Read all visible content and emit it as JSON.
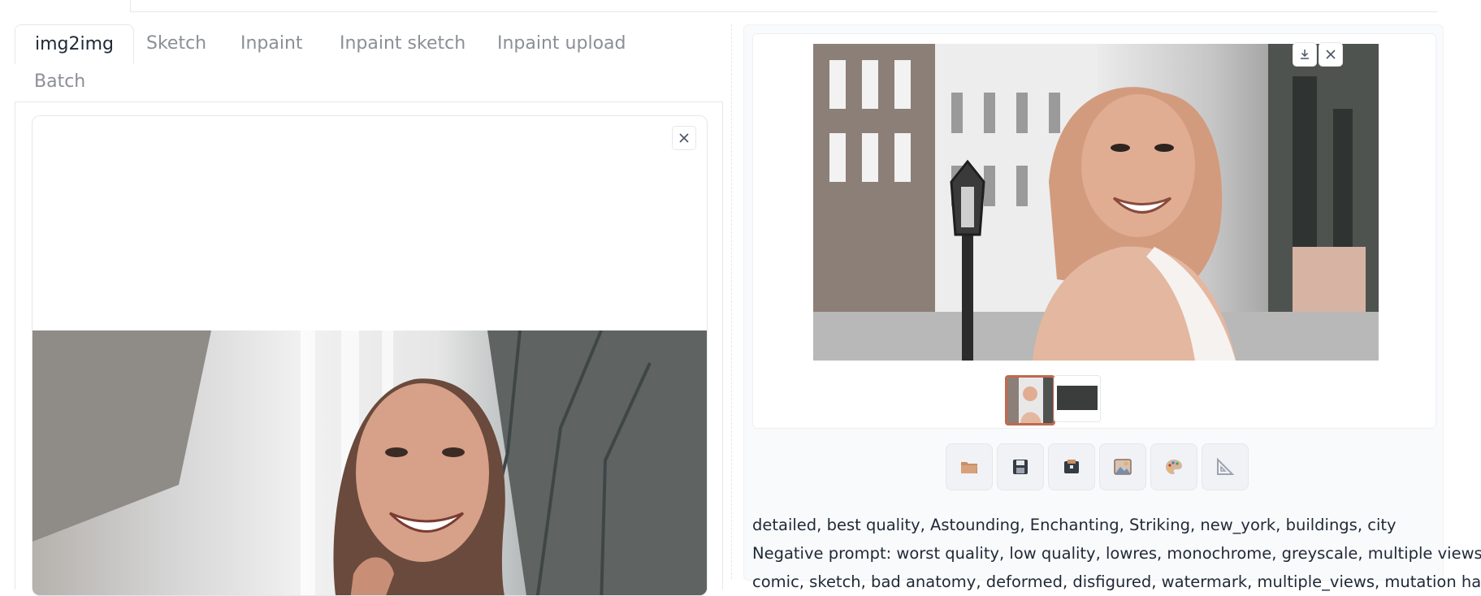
{
  "tabs": {
    "items": [
      {
        "label": "img2img",
        "active": true
      },
      {
        "label": "Sketch",
        "active": false
      },
      {
        "label": "Inpaint",
        "active": false
      },
      {
        "label": "Inpaint sketch",
        "active": false
      },
      {
        "label": "Inpaint upload",
        "active": false
      },
      {
        "label": "Batch",
        "active": false
      }
    ]
  },
  "input_image": {
    "content": "photo of a smiling woman with a hand near her ear, blurred trees in background"
  },
  "output": {
    "main_image": {
      "content": "photo of a smiling woman with wind-blown hair beside a street lamp on a city street"
    },
    "thumbnails": [
      {
        "state": "selected"
      },
      {
        "state": "unselected"
      }
    ],
    "action_buttons": [
      {
        "icon": "folder-icon"
      },
      {
        "icon": "save-icon"
      },
      {
        "icon": "zip-icon"
      },
      {
        "icon": "image-icon"
      },
      {
        "icon": "palette-icon"
      },
      {
        "icon": "ruler-triangle-icon"
      }
    ],
    "generation_info": [
      "detailed, best quality, Astounding, Enchanting, Striking, new_york, buildings, city",
      "Negative prompt: worst quality, low quality, lowres, monochrome, greyscale, multiple views,",
      "comic, sketch, bad anatomy, deformed, disfigured, watermark, multiple_views, mutation hands,"
    ]
  },
  "colors": {
    "accent": "#c0694d",
    "border": "#e5e7eb"
  }
}
